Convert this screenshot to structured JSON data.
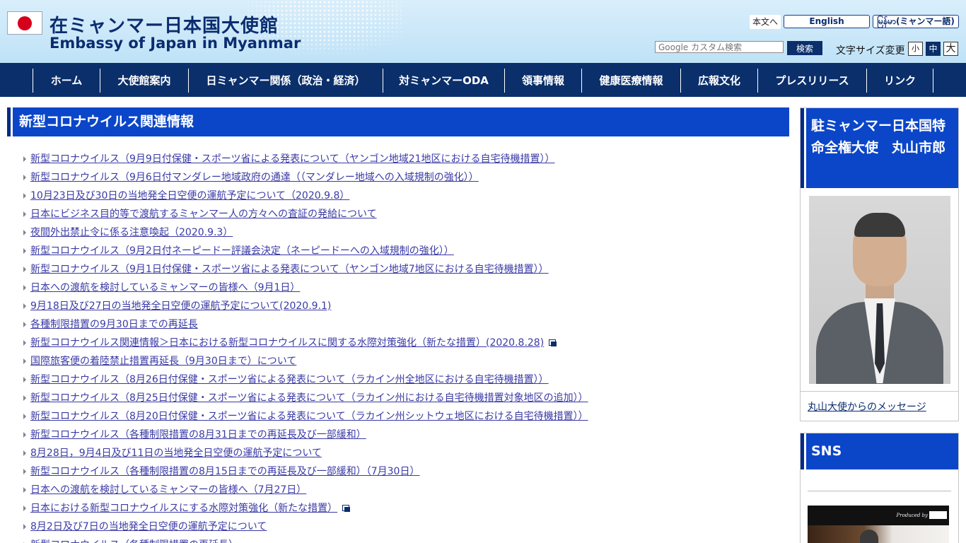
{
  "header": {
    "title_ja": "在ミャンマー日本国大使館",
    "title_en": "Embassy of Japan in Myanmar",
    "skip_link": "本文へ",
    "lang_en": "English",
    "lang_my": "မြန်မာ(ミャンマー語)",
    "search_placeholder": "Google カスタム検索",
    "search_button": "検索",
    "fontsize_label": "文字サイズ変更",
    "fontsize_small": "小",
    "fontsize_medium": "中",
    "fontsize_large": "大"
  },
  "nav": [
    "ホーム",
    "大使館案内",
    "日ミャンマー関係（政治・経済）",
    "対ミャンマーODA",
    "領事情報",
    "健康医療情報",
    "広報文化",
    "プレスリリース",
    "リンク"
  ],
  "main": {
    "heading": "新型コロナウイルス関連情報",
    "items": [
      {
        "text": "新型コロナウイルス（9月9日付保健・スポーツ省による発表について（ヤンゴン地域21地区における自宅待機措置））",
        "external": false
      },
      {
        "text": "新型コロナウイルス（9月6日付マンダレー地域政府の通達（（マンダレー地域への入域規制の強化））",
        "external": false
      },
      {
        "text": "10月23日及び30日の当地発全日空便の運航予定について（2020.9.8）",
        "external": false
      },
      {
        "text": "日本にビジネス目的等で渡航するミャンマー人の方々への査証の発給について",
        "external": false
      },
      {
        "text": "夜間外出禁止令に係る注意喚起（2020.9.3）",
        "external": false
      },
      {
        "text": "新型コロナウイルス（9月2日付ネーピードー評議会決定（ネーピードーへの入域規制の強化））",
        "external": false
      },
      {
        "text": "新型コロナウイルス（9月1日付保健・スポーツ省による発表について（ヤンゴン地域7地区における自宅待機措置））",
        "external": false
      },
      {
        "text": "日本への渡航を検討しているミャンマーの皆様へ（9月1日）",
        "external": false
      },
      {
        "text": "9月18日及び27日の当地発全日空便の運航予定について(2020.9.1)",
        "external": false
      },
      {
        "text": "各種制限措置の9月30日までの再延長",
        "external": false
      },
      {
        "text": "新型コロナウイルス関連情報＞日本における新型コロナウイルスに関する水際対策強化（新たな措置）(2020.8.28)",
        "external": true
      },
      {
        "text": "国際旅客便の着陸禁止措置再延長（9月30日まで）について",
        "external": false
      },
      {
        "text": "新型コロナウイルス（8月26日付保健・スポーツ省による発表について（ラカイン州全地区における自宅待機措置））",
        "external": false
      },
      {
        "text": "新型コロナウイルス（8月25日付保健・スポーツ省による発表について（ラカイン州における自宅待機措置対象地区の追加））",
        "external": false
      },
      {
        "text": "新型コロナウイルス（8月20日付保健・スポーツ省による発表について（ラカイン州シットウェ地区における自宅待機措置））",
        "external": false
      },
      {
        "text": "新型コロナウイルス（各種制限措置の8月31日までの再延長及び一部緩和）",
        "external": false
      },
      {
        "text": "8月28日，9月4日及び11日の当地発全日空便の運航予定について",
        "external": false
      },
      {
        "text": "新型コロナウイルス（各種制限措置の8月15日までの再延長及び一部緩和）（7月30日）",
        "external": false
      },
      {
        "text": "日本への渡航を検討しているミャンマーの皆様へ（7月27日）",
        "external": false
      },
      {
        "text": "日本における新型コロナウイルスにする水際対策強化（新たな措置）",
        "external": true
      },
      {
        "text": "8月2日及び7日の当地発全日空便の運航予定について",
        "external": false
      },
      {
        "text": "新型コロナウイルス（各種制限措置の再延長）",
        "external": false
      }
    ]
  },
  "sidebar": {
    "ambassador_heading": "駐ミャンマー日本国特命全権大使　丸山市郎",
    "ambassador_link": "丸山大使からのメッセージ",
    "sns_heading": "SNS",
    "video_credit": "Produced by"
  }
}
